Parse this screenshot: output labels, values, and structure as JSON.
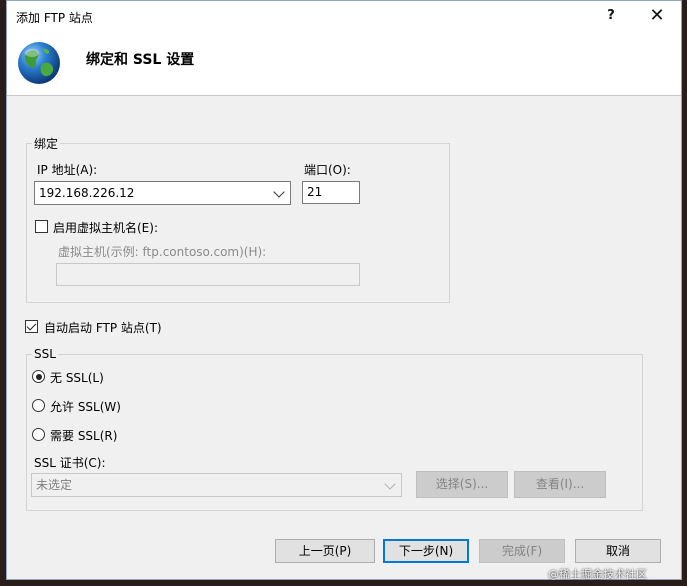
{
  "window": {
    "title": "添加 FTP 站点",
    "help_glyph": "?",
    "close_glyph": "✕"
  },
  "header": {
    "title": "绑定和 SSL 设置",
    "icon": "globe-icon"
  },
  "binding": {
    "group_label": "绑定",
    "ip_label": "IP 地址(A):",
    "ip_value": "192.168.226.12",
    "port_label": "端口(O):",
    "port_value": "21",
    "virtual_host_checkbox_label": "启用虚拟主机名(E):",
    "virtual_host_checked": false,
    "virtual_host_label": "虚拟主机(示例: ftp.contoso.com)(H):",
    "virtual_host_value": ""
  },
  "auto_start": {
    "label": "自动启动 FTP 站点(T)",
    "checked": true
  },
  "ssl": {
    "group_label": "SSL",
    "options": [
      {
        "label": "无 SSL(L)",
        "selected": true
      },
      {
        "label": "允许 SSL(W)",
        "selected": false
      },
      {
        "label": "需要 SSL(R)",
        "selected": false
      }
    ],
    "cert_label": "SSL 证书(C):",
    "cert_value": "未选定",
    "select_button": "选择(S)...",
    "view_button": "查看(I)..."
  },
  "footer": {
    "prev_button": "上一页(P)",
    "next_button": "下一步(N)",
    "finish_button": "完成(F)",
    "cancel_button": "取消"
  },
  "watermark": "@稀土掘金技术社区",
  "colors": {
    "accent": "#0078d7",
    "dialog_bg": "#f0f0f0",
    "header_bg": "#ffffff"
  }
}
